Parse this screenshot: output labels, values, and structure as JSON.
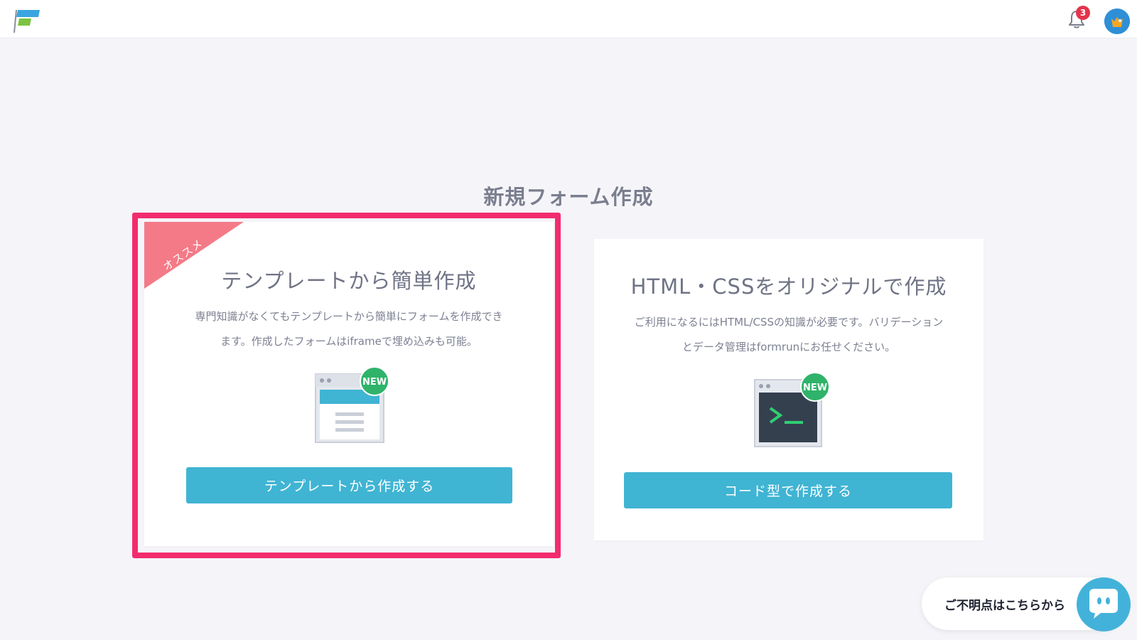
{
  "header": {
    "notification_count": "3",
    "colors": {
      "logo_blue": "#3aa5e0",
      "logo_green": "#7dc242",
      "badge": "#e3344b"
    }
  },
  "page": {
    "title": "新規フォーム作成"
  },
  "cards": [
    {
      "ribbon": "オススメ",
      "title": "テンプレートから簡単作成",
      "desc_line1": "専門知識がなくてもテンプレートから簡単にフォームを作成でき",
      "desc_line2": "ます。作成したフォームはiframeで埋め込みも可能。",
      "icon": "form-template-icon",
      "badge": "NEW",
      "button": "テンプレートから作成する",
      "highlighted": true
    },
    {
      "title": "HTML・CSSをオリジナルで作成",
      "desc_line1": "ご利用になるにはHTML/CSSの知識が必要です。バリデーション",
      "desc_line2": "とデータ管理はformrunにお任せください。",
      "icon": "terminal-icon",
      "badge": "NEW",
      "button": "コード型で作成する"
    }
  ],
  "help": {
    "label": "ご不明点はこちらから",
    "icon": "chat-bubble-icon"
  },
  "colors": {
    "accent": "#40b4d3",
    "highlight": "#f22c6e",
    "ribbon": "#f47a87",
    "new_badge": "#2fb36a"
  }
}
